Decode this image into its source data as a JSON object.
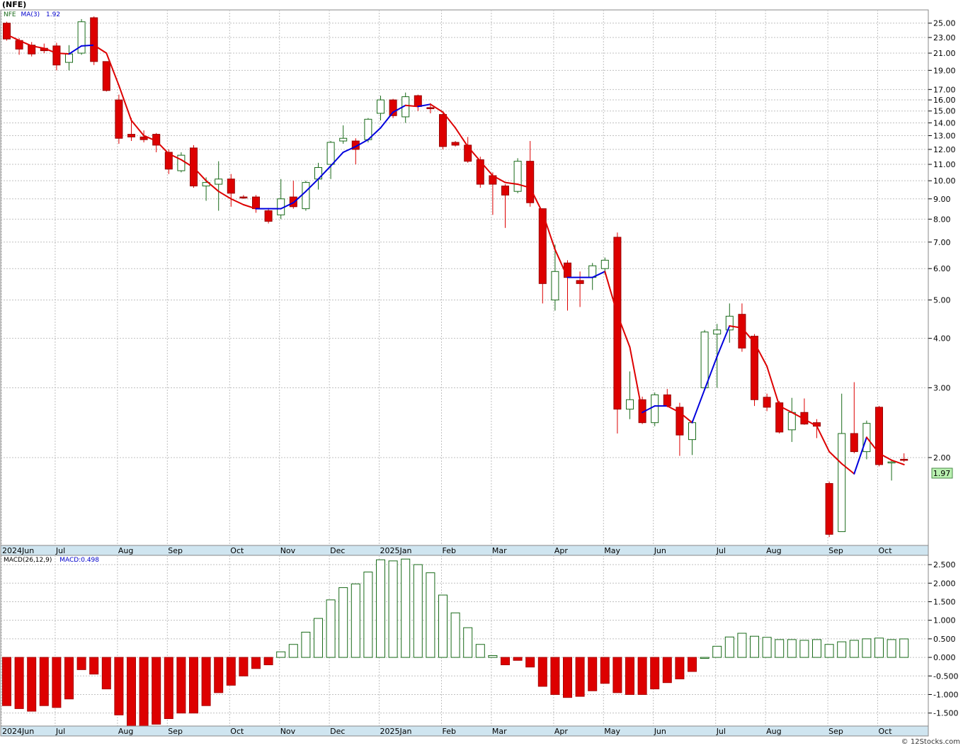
{
  "symbol": "(NFE)",
  "watermark": "© 12Stocks.com",
  "colors": {
    "up": "#1a6b1a",
    "down": "#dd0000",
    "ma_up": "#0000dd",
    "ma_down": "#dd0000",
    "grid": "#c0c0c0",
    "axis_band": "#cfe5f0",
    "last_tag": "#b9f0b0"
  },
  "chart_data": [
    {
      "type": "candlestick",
      "title": "(NFE)",
      "legend": {
        "symbol": "NFE",
        "indicator": "MA(3)",
        "indicator_value": "1.92"
      },
      "y_scale": "log",
      "ylim": [
        1.2,
        27
      ],
      "y_ticks": [
        "25.00",
        "23.00",
        "21.00",
        "19.00",
        "17.00",
        "16.00",
        "15.00",
        "14.00",
        "13.00",
        "12.00",
        "11.00",
        "10.00",
        "9.00",
        "8.00",
        "7.00",
        "6.00",
        "5.00",
        "4.00",
        "3.00",
        "2.00"
      ],
      "last_value": "1.97",
      "x_labels": [
        "2024Jun",
        "Jul",
        "Aug",
        "Sep",
        "Oct",
        "Nov",
        "Dec",
        "2025Jan",
        "Feb",
        "Mar",
        "Apr",
        "May",
        "Jun",
        "Jul",
        "Aug",
        "Sep",
        "Oct"
      ],
      "candles": [
        {
          "o": 25.0,
          "h": 25.2,
          "l": 22.6,
          "c": 22.8
        },
        {
          "o": 22.6,
          "h": 22.9,
          "l": 20.8,
          "c": 21.5
        },
        {
          "o": 22.0,
          "h": 22.4,
          "l": 20.6,
          "c": 20.9
        },
        {
          "o": 21.6,
          "h": 22.2,
          "l": 21.0,
          "c": 21.3
        },
        {
          "o": 21.9,
          "h": 22.3,
          "l": 19.0,
          "c": 19.6
        },
        {
          "o": 19.9,
          "h": 22.0,
          "l": 19.0,
          "c": 20.9
        },
        {
          "o": 21.0,
          "h": 25.6,
          "l": 20.8,
          "c": 25.2
        },
        {
          "o": 25.8,
          "h": 26.0,
          "l": 19.6,
          "c": 20.0
        },
        {
          "o": 20.0,
          "h": 20.0,
          "l": 16.8,
          "c": 16.9
        },
        {
          "o": 16.0,
          "h": 16.5,
          "l": 12.4,
          "c": 12.8
        },
        {
          "o": 13.1,
          "h": 14.4,
          "l": 12.6,
          "c": 12.9
        },
        {
          "o": 12.9,
          "h": 13.4,
          "l": 12.5,
          "c": 12.7
        },
        {
          "o": 13.1,
          "h": 13.2,
          "l": 11.8,
          "c": 12.3
        },
        {
          "o": 11.8,
          "h": 12.0,
          "l": 10.4,
          "c": 10.7
        },
        {
          "o": 10.6,
          "h": 11.8,
          "l": 10.5,
          "c": 11.6
        },
        {
          "o": 12.1,
          "h": 12.3,
          "l": 9.6,
          "c": 9.7
        },
        {
          "o": 9.7,
          "h": 10.2,
          "l": 8.9,
          "c": 9.9
        },
        {
          "o": 9.8,
          "h": 11.2,
          "l": 8.4,
          "c": 10.1
        },
        {
          "o": 10.1,
          "h": 10.4,
          "l": 8.6,
          "c": 9.3
        },
        {
          "o": 9.1,
          "h": 9.2,
          "l": 9.0,
          "c": 9.05
        },
        {
          "o": 9.1,
          "h": 9.2,
          "l": 8.3,
          "c": 8.5
        },
        {
          "o": 8.4,
          "h": 8.5,
          "l": 7.8,
          "c": 7.9
        },
        {
          "o": 8.2,
          "h": 10.1,
          "l": 8.0,
          "c": 9.0
        },
        {
          "o": 9.1,
          "h": 10.0,
          "l": 8.5,
          "c": 8.6
        },
        {
          "o": 8.5,
          "h": 10.0,
          "l": 8.4,
          "c": 9.9
        },
        {
          "o": 10.1,
          "h": 11.1,
          "l": 9.5,
          "c": 10.8
        },
        {
          "o": 11.0,
          "h": 12.6,
          "l": 10.1,
          "c": 12.5
        },
        {
          "o": 12.6,
          "h": 13.8,
          "l": 12.4,
          "c": 12.8
        },
        {
          "o": 12.6,
          "h": 12.8,
          "l": 11.0,
          "c": 12.0
        },
        {
          "o": 12.7,
          "h": 14.4,
          "l": 12.5,
          "c": 14.3
        },
        {
          "o": 14.8,
          "h": 16.4,
          "l": 14.2,
          "c": 16.0
        },
        {
          "o": 16.0,
          "h": 16.1,
          "l": 14.4,
          "c": 14.6
        },
        {
          "o": 14.5,
          "h": 16.7,
          "l": 14.0,
          "c": 16.3
        },
        {
          "o": 16.4,
          "h": 16.5,
          "l": 15.0,
          "c": 15.4
        },
        {
          "o": 15.3,
          "h": 15.7,
          "l": 14.8,
          "c": 15.2
        },
        {
          "o": 14.7,
          "h": 14.8,
          "l": 12.0,
          "c": 12.2
        },
        {
          "o": 12.5,
          "h": 12.6,
          "l": 12.2,
          "c": 12.3
        },
        {
          "o": 12.3,
          "h": 12.9,
          "l": 11.1,
          "c": 11.2
        },
        {
          "o": 11.3,
          "h": 11.5,
          "l": 9.6,
          "c": 9.8
        },
        {
          "o": 10.3,
          "h": 10.5,
          "l": 8.2,
          "c": 9.8
        },
        {
          "o": 9.7,
          "h": 9.8,
          "l": 7.6,
          "c": 9.2
        },
        {
          "o": 9.4,
          "h": 11.4,
          "l": 9.3,
          "c": 11.2
        },
        {
          "o": 11.2,
          "h": 12.6,
          "l": 8.6,
          "c": 8.8
        },
        {
          "o": 8.5,
          "h": 8.5,
          "l": 4.9,
          "c": 5.5
        },
        {
          "o": 5.0,
          "h": 6.9,
          "l": 4.7,
          "c": 5.9
        },
        {
          "o": 6.2,
          "h": 6.3,
          "l": 4.7,
          "c": 5.7
        },
        {
          "o": 5.6,
          "h": 5.9,
          "l": 4.8,
          "c": 5.5
        },
        {
          "o": 5.7,
          "h": 6.2,
          "l": 5.3,
          "c": 6.1
        },
        {
          "o": 6.0,
          "h": 6.4,
          "l": 5.8,
          "c": 6.3
        },
        {
          "o": 7.2,
          "h": 7.4,
          "l": 2.3,
          "c": 2.65
        },
        {
          "o": 2.65,
          "h": 3.3,
          "l": 2.5,
          "c": 2.8
        },
        {
          "o": 2.8,
          "h": 2.85,
          "l": 2.43,
          "c": 2.45
        },
        {
          "o": 2.45,
          "h": 2.92,
          "l": 2.4,
          "c": 2.88
        },
        {
          "o": 2.88,
          "h": 2.98,
          "l": 2.68,
          "c": 2.7
        },
        {
          "o": 2.68,
          "h": 2.75,
          "l": 2.02,
          "c": 2.28
        },
        {
          "o": 2.22,
          "h": 2.48,
          "l": 2.03,
          "c": 2.45
        },
        {
          "o": 3.0,
          "h": 4.2,
          "l": 3.0,
          "c": 4.15
        },
        {
          "o": 4.1,
          "h": 4.35,
          "l": 3.0,
          "c": 4.2
        },
        {
          "o": 4.2,
          "h": 4.9,
          "l": 3.9,
          "c": 4.55
        },
        {
          "o": 4.6,
          "h": 4.9,
          "l": 3.7,
          "c": 3.78
        },
        {
          "o": 4.05,
          "h": 4.1,
          "l": 2.7,
          "c": 2.8
        },
        {
          "o": 2.84,
          "h": 2.9,
          "l": 2.62,
          "c": 2.68
        },
        {
          "o": 2.75,
          "h": 2.78,
          "l": 2.3,
          "c": 2.32
        },
        {
          "o": 2.35,
          "h": 2.83,
          "l": 2.19,
          "c": 2.6
        },
        {
          "o": 2.6,
          "h": 2.82,
          "l": 2.42,
          "c": 2.43
        },
        {
          "o": 2.45,
          "h": 2.5,
          "l": 2.24,
          "c": 2.4
        },
        {
          "o": 1.72,
          "h": 1.74,
          "l": 1.26,
          "c": 1.28
        },
        {
          "o": 1.3,
          "h": 2.9,
          "l": 1.3,
          "c": 2.3
        },
        {
          "o": 2.3,
          "h": 3.1,
          "l": 2.05,
          "c": 2.07
        },
        {
          "o": 2.07,
          "h": 2.48,
          "l": 1.98,
          "c": 2.44
        },
        {
          "o": 2.68,
          "h": 2.7,
          "l": 1.9,
          "c": 1.92
        },
        {
          "o": 1.94,
          "h": 1.96,
          "l": 1.75,
          "c": 1.95
        },
        {
          "o": 1.98,
          "h": 2.05,
          "l": 1.95,
          "c": 1.97
        }
      ],
      "ma": [
        23.4,
        22.6,
        21.9,
        21.6,
        21.0,
        20.9,
        21.9,
        22.0,
        21.0,
        17.4,
        14.2,
        13.0,
        12.6,
        11.7,
        11.3,
        10.8,
        10.0,
        9.4,
        9.0,
        8.7,
        8.5,
        8.5,
        8.5,
        8.8,
        9.4,
        10.1,
        10.9,
        11.8,
        12.2,
        12.7,
        13.6,
        14.9,
        15.5,
        15.4,
        15.6,
        14.9,
        13.6,
        12.2,
        11.2,
        10.3,
        9.9,
        9.8,
        9.6,
        8.3,
        6.7,
        5.7,
        5.7,
        5.7,
        5.9,
        4.6,
        3.8,
        2.6,
        2.7,
        2.7,
        2.6,
        2.45,
        2.97,
        3.6,
        4.3,
        4.25,
        3.9,
        3.4,
        2.7,
        2.6,
        2.5,
        2.4,
        2.07,
        1.93,
        1.82,
        2.25,
        2.05,
        1.97,
        1.92
      ]
    },
    {
      "type": "bar",
      "title": "MACD(26,12,9)",
      "series_label": "MACD:0.498",
      "ylim": [
        -1.85,
        2.75
      ],
      "y_ticks": [
        "2.500",
        "2.000",
        "1.500",
        "1.000",
        "0.500",
        "0.000",
        "-0.500",
        "-1.000",
        "-1.500"
      ],
      "x_labels": [
        "2024Jun",
        "Jul",
        "Aug",
        "Sep",
        "Oct",
        "Nov",
        "Dec",
        "2025Jan",
        "Feb",
        "Mar",
        "Apr",
        "May",
        "Jun",
        "Jul",
        "Aug",
        "Sep",
        "Oct"
      ],
      "values": [
        -1.3,
        -1.38,
        -1.45,
        -1.3,
        -1.35,
        -1.12,
        -0.33,
        -0.45,
        -0.85,
        -1.55,
        -1.85,
        -1.85,
        -1.8,
        -1.65,
        -1.5,
        -1.5,
        -1.3,
        -0.95,
        -0.75,
        -0.5,
        -0.3,
        -0.2,
        0.15,
        0.35,
        0.68,
        1.05,
        1.55,
        1.88,
        1.98,
        2.3,
        2.63,
        2.6,
        2.65,
        2.5,
        2.28,
        1.68,
        1.2,
        0.8,
        0.35,
        0.05,
        -0.2,
        -0.08,
        -0.26,
        -0.78,
        -1.0,
        -1.08,
        -1.05,
        -0.9,
        -0.7,
        -0.95,
        -1.0,
        -1.0,
        -0.85,
        -0.68,
        -0.58,
        -0.38,
        0.0,
        0.3,
        0.55,
        0.65,
        0.57,
        0.54,
        0.48,
        0.48,
        0.46,
        0.48,
        0.35,
        0.42,
        0.46,
        0.5,
        0.52,
        0.48,
        0.498
      ]
    }
  ]
}
